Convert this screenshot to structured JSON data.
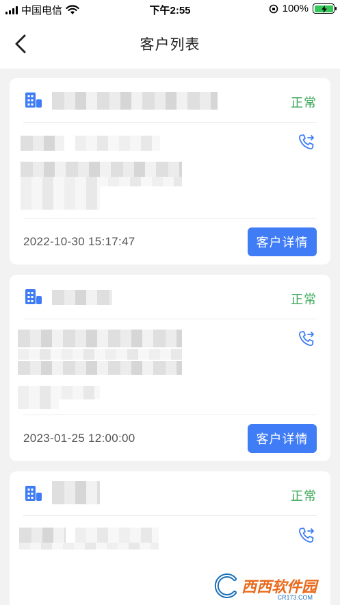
{
  "status_bar": {
    "carrier": "中国电信",
    "time": "下午2:55",
    "battery": "100%",
    "battery_level": 1.0
  },
  "nav": {
    "title": "客户列表",
    "back_icon": "chevron-left-icon"
  },
  "customers": [
    {
      "status": "正常",
      "time": "2022-10-30 15:17:47",
      "detail_label": "客户详情"
    },
    {
      "status": "正常",
      "time": "2023-01-25 12:00:00",
      "detail_label": "客户详情"
    },
    {
      "status": "正常",
      "time": "",
      "detail_label": ""
    }
  ],
  "colors": {
    "status_green": "#3aa757",
    "button_blue": "#3f7cf6",
    "icon_blue": "#3f7cf6"
  },
  "watermark": {
    "brand": "西西软件园",
    "site": "CR173.COM"
  }
}
